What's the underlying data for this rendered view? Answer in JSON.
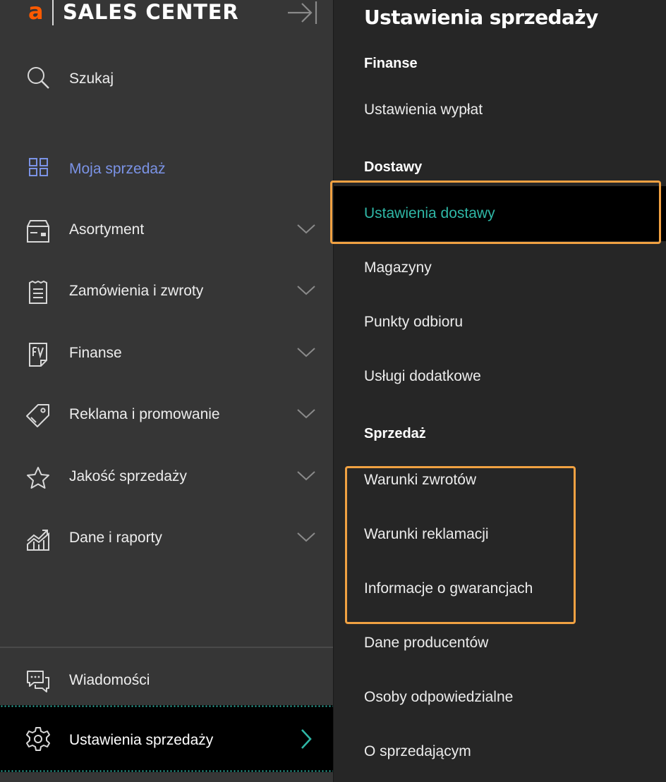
{
  "brand": {
    "logo_letter": "a",
    "name": "SALES CENTER"
  },
  "sidebar": {
    "search_label": "Szukaj",
    "items": [
      {
        "label": "Moja sprzedaż",
        "icon": "dashboard-grid-icon",
        "active": true
      },
      {
        "label": "Asortyment",
        "icon": "product-box-icon",
        "expandable": true
      },
      {
        "label": "Zamówienia i zwroty",
        "icon": "receipt-icon",
        "expandable": true
      },
      {
        "label": "Finanse",
        "icon": "invoice-fv-icon",
        "expandable": true
      },
      {
        "label": "Reklama i promowanie",
        "icon": "price-tag-icon",
        "expandable": true
      },
      {
        "label": "Jakość sprzedaży",
        "icon": "star-icon",
        "expandable": true
      },
      {
        "label": "Dane i raporty",
        "icon": "chart-growth-icon",
        "expandable": true
      }
    ],
    "messages_label": "Wiadomości",
    "settings_label": "Ustawienia sprzedaży"
  },
  "panel": {
    "title": "Ustawienia sprzedaży",
    "sections": [
      {
        "heading": "Finanse",
        "links": [
          "Ustawienia wypłat"
        ]
      },
      {
        "heading": "Dostawy",
        "links": [
          "Ustawienia dostawy",
          "Magazyny",
          "Punkty odbioru",
          "Usługi dodatkowe"
        ]
      },
      {
        "heading": "Sprzedaż",
        "links": [
          "Warunki zwrotów",
          "Warunki reklamacji",
          "Informacje o gwarancjach",
          "Dane producentów",
          "Osoby odpowiedzialne",
          "O sprzedającym"
        ]
      }
    ],
    "selected_link": "Ustawienia dostawy"
  },
  "colors": {
    "accent_orange": "#ff5a00",
    "active_blue": "#7b93e6",
    "teal": "#2fb7a6",
    "highlight_box": "#f0a142",
    "sidebar_bg": "#363636",
    "panel_bg": "#262626"
  }
}
